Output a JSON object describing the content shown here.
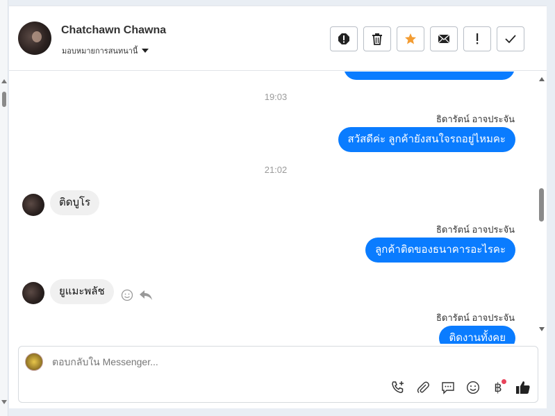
{
  "header": {
    "contact_name": "Chatchawn Chawna",
    "assign_label": "มอบหมายการสนทนานี้",
    "actions": [
      {
        "name": "report-icon",
        "label": "!"
      },
      {
        "name": "trash-icon",
        "label": ""
      },
      {
        "name": "star-icon",
        "label": ""
      },
      {
        "name": "envelope-icon",
        "label": ""
      },
      {
        "name": "exclamation-icon",
        "label": "!"
      },
      {
        "name": "check-icon",
        "label": ""
      }
    ]
  },
  "conversation": {
    "timestamps": [
      "19:03",
      "21:02"
    ],
    "messages": [
      {
        "direction": "outgoing",
        "sender": "ธิดารัตน์ อาจประจัน",
        "text": "สวัสดีค่ะ ลูกค้ายังสนใจรถอยู่ไหมคะ"
      },
      {
        "direction": "incoming",
        "text": "ติดบูโร"
      },
      {
        "direction": "outgoing",
        "sender": "ธิดารัตน์ อาจประจัน",
        "text": "ลูกค้าติดของธนาคารอะไรคะ"
      },
      {
        "direction": "incoming",
        "text": "ยูแมะพลัช"
      },
      {
        "direction": "outgoing",
        "sender": "ธิดารัตน์ อาจประจัน",
        "text": "ติดงานทั้งคย"
      }
    ]
  },
  "composer": {
    "placeholder": "ตอบกลับใน Messenger...",
    "tools": [
      "phone-add-icon",
      "paperclip-icon",
      "chat-bubble-icon",
      "emoji-icon",
      "baht-icon",
      "thumbs-up-icon"
    ]
  },
  "colors": {
    "outgoing_bubble": "#0a7cff",
    "incoming_bubble": "#f0f0f0",
    "star": "#f39c32"
  }
}
